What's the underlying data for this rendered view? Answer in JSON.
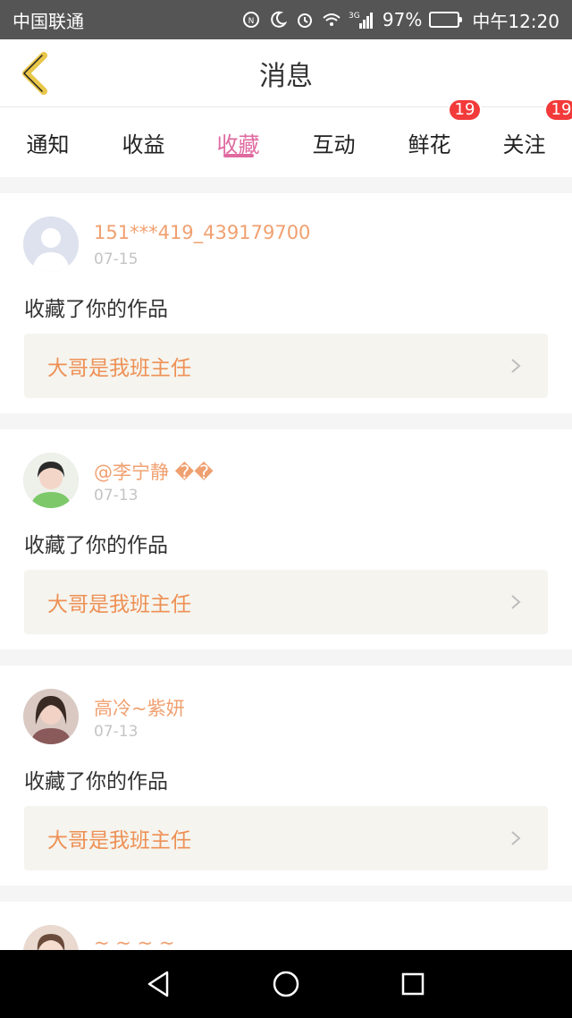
{
  "status_bar": {
    "carrier": "中国联通",
    "network": "3G",
    "battery": "97%",
    "time": "中午12:20"
  },
  "header": {
    "title": "消息"
  },
  "tabs": [
    {
      "label": "通知",
      "badge": ""
    },
    {
      "label": "收益",
      "badge": ""
    },
    {
      "label": "收藏",
      "badge": "",
      "active": true
    },
    {
      "label": "互动",
      "badge": ""
    },
    {
      "label": "鲜花",
      "badge": "19"
    },
    {
      "label": "关注",
      "badge": "19"
    }
  ],
  "items": [
    {
      "user": "151***419_439179700",
      "date": "07-15",
      "action": "收藏了你的作品",
      "work": "大哥是我班主任"
    },
    {
      "user": "@李宁静 ��",
      "date": "07-13",
      "action": "收藏了你的作品",
      "work": "大哥是我班主任"
    },
    {
      "user": "高冷~紫妍",
      "date": "07-13",
      "action": "收藏了你的作品",
      "work": "大哥是我班主任"
    },
    {
      "user": "~ ~ ~ ~",
      "date": "",
      "action": "",
      "work": ""
    }
  ],
  "colors": {
    "accent": "#e06aa0",
    "username": "#f0a070",
    "work_title": "#ee9055",
    "badge": "#f23a3a",
    "back_arrow": "#e8c64a"
  }
}
